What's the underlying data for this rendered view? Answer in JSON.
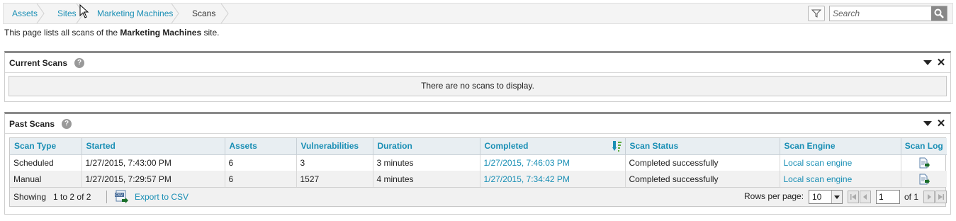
{
  "breadcrumb": {
    "items": [
      {
        "label": "Assets"
      },
      {
        "label": "Sites"
      },
      {
        "label": "Marketing Machines"
      },
      {
        "label": "Scans"
      }
    ]
  },
  "search": {
    "placeholder": "Search"
  },
  "description": {
    "prefix": "This page lists all scans of the ",
    "site": "Marketing Machines",
    "suffix": " site."
  },
  "current_scans": {
    "title": "Current Scans",
    "empty_message": "There are no scans to display."
  },
  "past_scans": {
    "title": "Past Scans",
    "columns": [
      "Scan Type",
      "Started",
      "Assets",
      "Vulnerabilities",
      "Duration",
      "Completed",
      "Scan Status",
      "Scan Engine",
      "Scan Log"
    ],
    "rows": [
      {
        "type": "Scheduled",
        "started": "1/27/2015, 7:43:00 PM",
        "assets": "6",
        "vulnerabilities": "3",
        "duration": "3 minutes",
        "completed": "1/27/2015, 7:46:03 PM",
        "status": "Completed successfully",
        "engine": "Local scan engine"
      },
      {
        "type": "Manual",
        "started": "1/27/2015, 7:29:57 PM",
        "assets": "6",
        "vulnerabilities": "1527",
        "duration": "4 minutes",
        "completed": "1/27/2015, 7:34:42 PM",
        "status": "Completed successfully",
        "engine": "Local scan engine"
      }
    ],
    "footer": {
      "showing": "Showing   1 to 2 of 2",
      "export": "Export to CSV",
      "rows_per_page_label": "Rows per page:",
      "rows_per_page": "10",
      "page": "1",
      "of": "of 1"
    }
  },
  "colors": {
    "link": "#1a8fb5",
    "panel_border": "#8a8a8a",
    "header_bg": "#e8eef2"
  }
}
